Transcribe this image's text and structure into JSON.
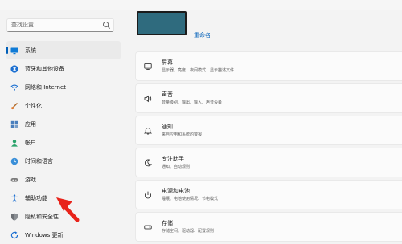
{
  "search": {
    "placeholder": "查找设置"
  },
  "nav": {
    "items": [
      {
        "label": "系统",
        "icon": "monitor-icon",
        "active": true
      },
      {
        "label": "蓝牙和其他设备",
        "icon": "bluetooth-icon"
      },
      {
        "label": "网络和 Internet",
        "icon": "wifi-icon"
      },
      {
        "label": "个性化",
        "icon": "brush-icon"
      },
      {
        "label": "应用",
        "icon": "apps-icon"
      },
      {
        "label": "帐户",
        "icon": "person-icon"
      },
      {
        "label": "时间和语言",
        "icon": "globe-clock-icon"
      },
      {
        "label": "游戏",
        "icon": "gamepad-icon"
      },
      {
        "label": "辅助功能",
        "icon": "accessibility-icon"
      },
      {
        "label": "隐私和安全性",
        "icon": "shield-icon"
      },
      {
        "label": "Windows 更新",
        "icon": "update-icon"
      }
    ]
  },
  "device": {
    "rename_label": "重命名"
  },
  "cards": [
    {
      "title": "屏幕",
      "desc": "显示器、亮度、夜间模式、显示描述文件",
      "icon": "display-icon"
    },
    {
      "title": "声音",
      "desc": "音量级别、输出、输入、声音设备",
      "icon": "speaker-icon"
    },
    {
      "title": "通知",
      "desc": "来自应用和系统的警报",
      "icon": "bell-icon"
    },
    {
      "title": "专注助手",
      "desc": "通知、自动规则",
      "icon": "moon-icon"
    },
    {
      "title": "电源和电池",
      "desc": "睡眠、电池使用情况、节电模式",
      "icon": "power-icon"
    },
    {
      "title": "存储",
      "desc": "存储空间、驱动器、配置规则",
      "icon": "storage-icon"
    }
  ],
  "colors": {
    "accent": "#005fb8",
    "annotation_arrow": "#e8231a",
    "device_thumb": "#2f6b7e"
  }
}
